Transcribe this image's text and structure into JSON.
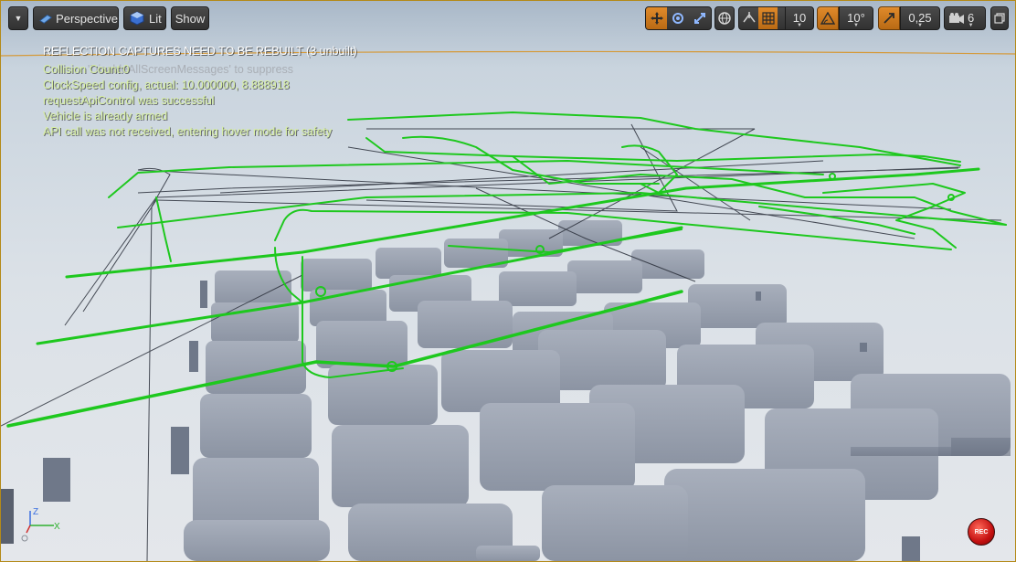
{
  "toolbar": {
    "view_mode": "Perspective",
    "lit_label": "Lit",
    "show_label": "Show",
    "grid_snap_value": "10",
    "rotation_snap_value": "10°",
    "scale_snap_value": "0,25",
    "camera_speed_value": "6"
  },
  "messages": {
    "rebuild_warning": "REFLECTION CAPTURES NEED TO BE REBUILT (3 unbuilt)",
    "suppress_hint": "'DisableAllScreenMessages' to suppress",
    "collision_count": "Collision Count:0",
    "clockspeed": "ClockSpeed config, actual: 10.000000, 8.888918",
    "api_control": "requestApiControl was successful",
    "armed": "Vehicle is already armed",
    "hover": "API call was not received, entering hover mode for safety"
  },
  "axis": {
    "z_label": "Z",
    "x_label": "X"
  },
  "record_label": "REC",
  "colors": {
    "accent_orange": "#d9822b",
    "trajectory_green": "#1ec81e",
    "warning_text": "#ffffff",
    "info_text": "#d8f0a0",
    "sky_top": "#d7dde4",
    "block_gray": "#8d95a5"
  }
}
